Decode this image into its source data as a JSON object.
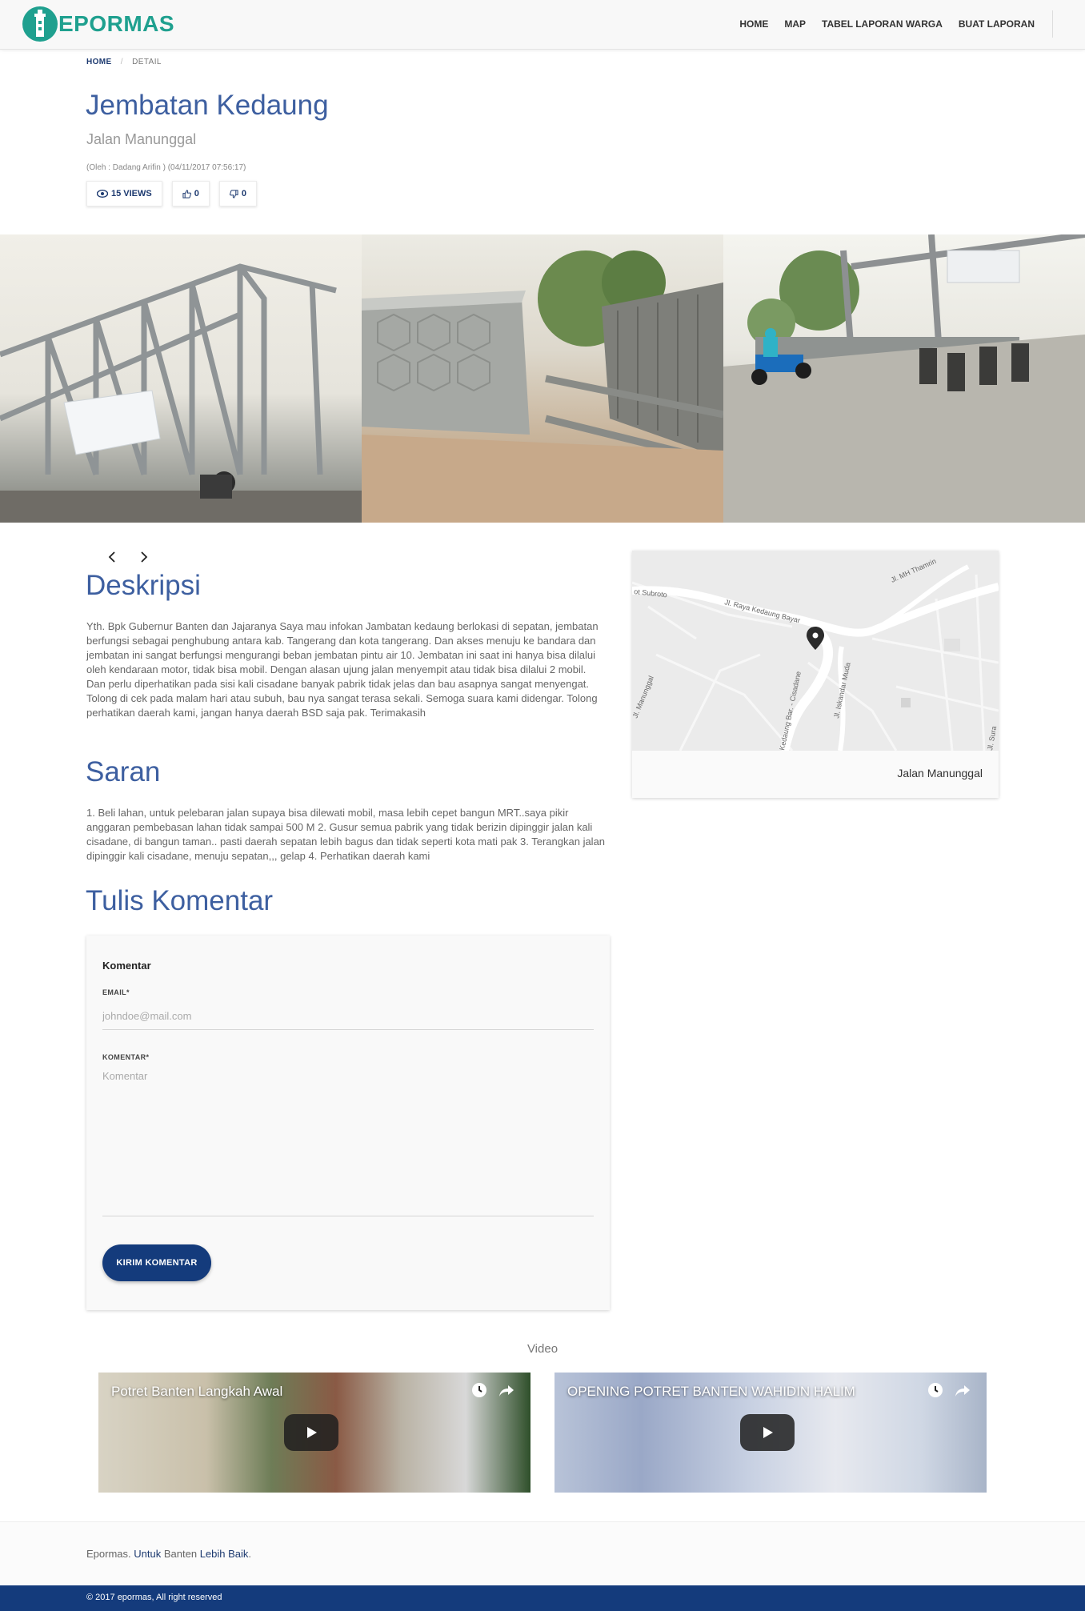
{
  "brand": {
    "name": "EPORMAS",
    "accent_color": "#1fa08f",
    "primary_color": "#143b7c"
  },
  "nav": {
    "items": [
      "HOME",
      "MAP",
      "TABEL LAPORAN WARGA",
      "BUAT LAPORAN"
    ]
  },
  "breadcrumb": {
    "home": "HOME",
    "current": "DETAIL"
  },
  "report": {
    "title": "Jembatan Kedaung",
    "subtitle": "Jalan Manunggal",
    "meta": "(Oleh : Dadang Arifin ) (04/11/2017 07:56:17)",
    "views": "15 VIEWS",
    "likes": "0",
    "dislikes": "0"
  },
  "gallery": {
    "images": [
      "bridge-truss-photo",
      "bridge-railing-photo",
      "bridge-road-motorbike-photo"
    ]
  },
  "deskripsi": {
    "heading": "Deskripsi",
    "text": "Yth. Bpk Gubernur Banten dan Jajaranya Saya mau infokan Jambatan kedaung berlokasi di sepatan, jembatan berfungsi sebagai penghubung antara kab. Tangerang dan kota tangerang. Dan akses menuju ke bandara dan jembatan ini sangat berfungsi mengurangi beban jembatan pintu air 10. Jembatan ini saat ini hanya bisa dilalui oleh kendaraan motor, tidak bisa mobil. Dengan alasan ujung jalan menyempit atau tidak bisa dilalui 2 mobil. Dan perlu diperhatikan pada sisi kali cisadane banyak pabrik tidak jelas dan bau asapnya sangat menyengat. Tolong di cek pada malam hari atau subuh, bau nya sangat terasa sekali. Semoga suara kami didengar. Tolong perhatikan daerah kami, jangan hanya daerah BSD saja pak. Terimakasih"
  },
  "saran": {
    "heading": "Saran",
    "text": "1. Beli lahan, untuk pelebaran jalan supaya bisa dilewati mobil, masa lebih cepet bangun MRT..saya pikir anggaran pembebasan lahan tidak sampai 500 M 2. Gusur semua pabrik yang tidak berizin dipinggir jalan kali cisadane, di bangun taman.. pasti daerah sepatan lebih bagus dan tidak seperti kota mati pak 3. Terangkan jalan dipinggir kali cisadane, menuju sepatan,,, gelap 4. Perhatikan daerah kami"
  },
  "map": {
    "caption": "Jalan Manunggal",
    "labels": {
      "road1": "Jl. MH Thamrin",
      "road2": "Jl. Raya Kedaung Bayar",
      "road3": "ot Subroto",
      "road4": "Jl. Manunggal",
      "road5": "Kedaung Bar. - Cisadane",
      "road6": "Jl. Iskandar Muda",
      "road7": "Jl. Sura"
    }
  },
  "comment": {
    "section_heading": "Tulis Komentar",
    "card_heading": "Komentar",
    "email_label": "EMAIL*",
    "email_placeholder": "johndoe@mail.com",
    "komentar_label": "KOMENTAR*",
    "komentar_placeholder": "Komentar",
    "submit": "KIRIM KOMENTAR"
  },
  "videos": {
    "heading": "Video",
    "items": [
      {
        "title": "Potret Banten Langkah Awal"
      },
      {
        "title": "OPENING POTRET BANTEN WAHIDIN HALIM"
      }
    ]
  },
  "footer": {
    "w1": "Epormas.",
    "w2": "Untuk",
    "w3": "Banten",
    "w4": "Lebih Baik",
    "w5": ".",
    "copyright": "© 2017 epormas, All right reserved"
  }
}
